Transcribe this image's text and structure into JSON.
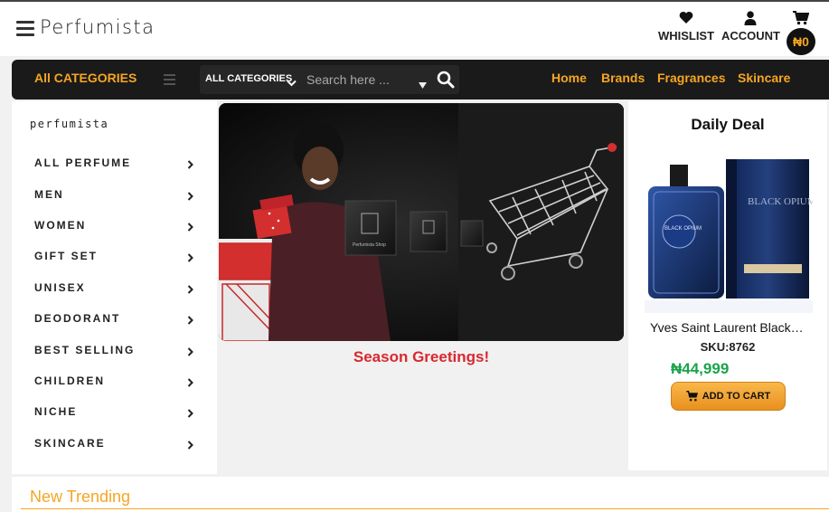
{
  "brand": {
    "logo": "Perfumista",
    "sidebar_logo": "perfumista"
  },
  "header": {
    "wishlist_label": "WHISLIST",
    "account_label": "ACCOUNT",
    "cart_total": "₦0"
  },
  "nav": {
    "all_categories": "All CATEGORIES",
    "search": {
      "category_label": "ALL CATEGORIES",
      "placeholder": "Search here ..."
    },
    "links": [
      "Home",
      "Brands",
      "Fragrances",
      "Skincare"
    ]
  },
  "sidebar": {
    "items": [
      "ALL PERFUME",
      "MEN",
      "WOMEN",
      "GIFT SET",
      "UNISEX",
      "DEODORANT",
      "BEST SELLING",
      "CHILDREN",
      "NICHE",
      "SKINCARE"
    ]
  },
  "banner": {
    "caption": "Season Greetings!",
    "box_label": "Perfumista Shop"
  },
  "deal": {
    "title": "Daily Deal",
    "product_name": "Yves Saint Laurent Black Opium",
    "sku": "SKU:8762",
    "price": "₦44,999",
    "button_label": "ADD TO CART",
    "bottle_label": "BLACK OPIUM",
    "box_label": "BLACK OPIUM"
  },
  "trending": {
    "title": "New Trending"
  },
  "colors": {
    "accent": "#f5a623",
    "nav_bg": "#1a1a1a",
    "price": "#1aa34a",
    "caption": "#d9282f"
  }
}
